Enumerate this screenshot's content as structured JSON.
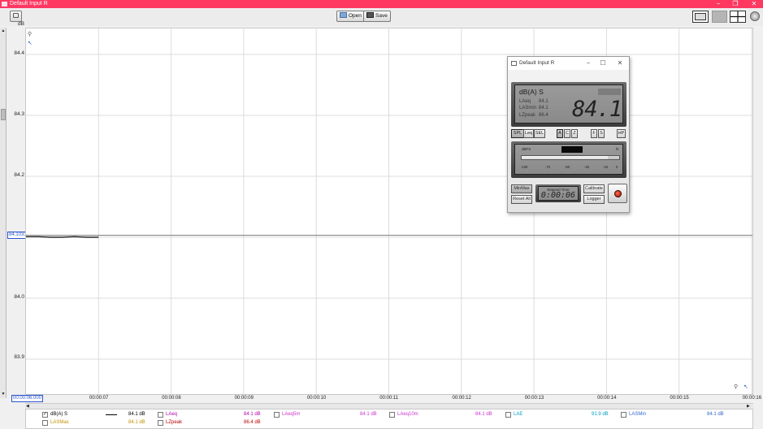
{
  "window": {
    "title": "Default Input R",
    "minimize": "−",
    "restore": "❐",
    "close": "✕"
  },
  "toolbar": {
    "open_label": "Open",
    "save_label": "Save"
  },
  "y_axis": {
    "unit": "dB",
    "ticks": [
      "84.4",
      "84.3",
      "84.2",
      "84.1",
      "84.0",
      "83.9"
    ]
  },
  "x_axis": {
    "cursor_start": "00:00:06.000",
    "ticks": [
      "00:00:07",
      "00:00:08",
      "00:00:09",
      "00:00:10",
      "00:00:11",
      "00:00:12",
      "00:00:13",
      "00:00:14",
      "00:00:15",
      "00:00:16"
    ]
  },
  "cursor": {
    "value": "84.1031"
  },
  "trace": {
    "color": "#000000",
    "values_db": [
      84.101,
      84.101,
      84.1,
      84.1,
      84.101,
      84.1,
      84.1
    ]
  },
  "legend": [
    {
      "label": "dB(A) S",
      "value": "84.1 dB",
      "checked": true,
      "color": "#000000",
      "has_line": true
    },
    {
      "label": "LAeq",
      "value": "84.1 dB",
      "checked": false,
      "color": "#b000b0"
    },
    {
      "label": "LAeq5m",
      "value": "84.1 dB",
      "checked": false,
      "color": "#cc33cc"
    },
    {
      "label": "LAeq10m",
      "value": "84.1 dB",
      "checked": false,
      "color": "#cc33cc"
    },
    {
      "label": "LAE",
      "value": "91.9 dB",
      "checked": false,
      "color": "#00a0c0"
    },
    {
      "label": "LASMin",
      "value": "84.1 dB",
      "checked": false,
      "color": "#3366cc"
    },
    {
      "label": "LASMax",
      "value": "84.1 dB",
      "checked": false,
      "color": "#c09000"
    },
    {
      "label": "LZpeak",
      "value": "86.4 dB",
      "checked": false,
      "color": "#c00000"
    }
  ],
  "meter": {
    "title": "Default Input R",
    "weighting": "dB(A) S",
    "mode_badge": "",
    "readings": [
      {
        "name": "LAeq",
        "value": "84.1"
      },
      {
        "name": "LASmin",
        "value": "84.1"
      },
      {
        "name": "LZpeak",
        "value": "86.4"
      }
    ],
    "big_value": "84.1",
    "buttons": [
      "SPL",
      "Leq",
      "SEL",
      "A",
      "C",
      "Z",
      "F",
      "S",
      "HP"
    ],
    "bar_label_left": "dBFS",
    "bar_label_right": "fs",
    "bar_level": 0.88,
    "bar_ticks": [
      "-100",
      "-70",
      "-50",
      "-30",
      "-10",
      "0"
    ],
    "minmax_label": "MinMax",
    "reset_label": "Reset All",
    "elapsed_label": "Elapsed Time",
    "elapsed_value": "0:00:06",
    "calibrate_label": "Calibrate",
    "logger_label": "Logger"
  }
}
